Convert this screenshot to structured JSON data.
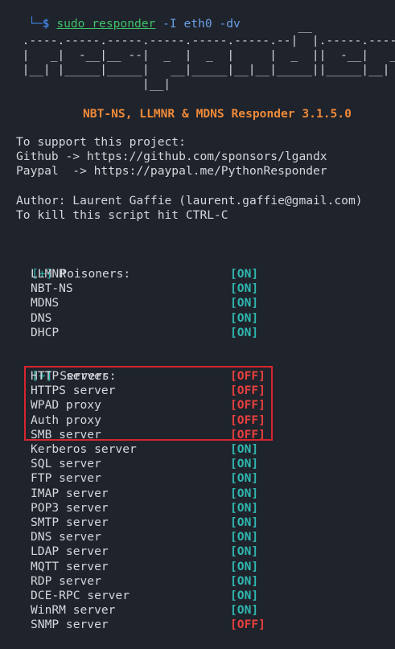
{
  "prompt": {
    "corner": "└─",
    "dollar": "$",
    "command": "sudo responder",
    "args": " -I eth0 -dv"
  },
  "banner_art": "                                         __\n  .----.-----.-----.-----.-----.-----.--|  |.-----.----.\n  |   _|  -__|__ --|  _  |  _  |     |  _  ||  -__|   _|\n  |__| |_____|_____|   __|_____|__|__|_____||_____|__|\n                   |__|",
  "title": "NBT-NS, LLMNR & MDNS Responder 3.1.5.0",
  "support": {
    "heading": "To support this project:",
    "github": "Github -> https://github.com/sponsors/lgandx",
    "paypal": "Paypal  -> https://paypal.me/PythonResponder"
  },
  "author": "Author: Laurent Gaffie (laurent.gaffie@gmail.com)",
  "kill_hint": "To kill this script hit CTRL-C",
  "poisoners": {
    "marker": "[+]",
    "heading": " Poisoners:",
    "items": [
      {
        "name": "LLMNR",
        "status": "[ON]"
      },
      {
        "name": "NBT-NS",
        "status": "[ON]"
      },
      {
        "name": "MDNS",
        "status": "[ON]"
      },
      {
        "name": "DNS",
        "status": "[ON]"
      },
      {
        "name": "DHCP",
        "status": "[ON]"
      }
    ]
  },
  "servers": {
    "marker": "[+]",
    "heading": " Servers:",
    "items": [
      {
        "name": "HTTP server",
        "status": "[OFF]"
      },
      {
        "name": "HTTPS server",
        "status": "[OFF]"
      },
      {
        "name": "WPAD proxy",
        "status": "[OFF]"
      },
      {
        "name": "Auth proxy",
        "status": "[OFF]"
      },
      {
        "name": "SMB server",
        "status": "[OFF]"
      },
      {
        "name": "Kerberos server",
        "status": "[ON]"
      },
      {
        "name": "SQL server",
        "status": "[ON]"
      },
      {
        "name": "FTP server",
        "status": "[ON]"
      },
      {
        "name": "IMAP server",
        "status": "[ON]"
      },
      {
        "name": "POP3 server",
        "status": "[ON]"
      },
      {
        "name": "SMTP server",
        "status": "[ON]"
      },
      {
        "name": "DNS server",
        "status": "[ON]"
      },
      {
        "name": "LDAP server",
        "status": "[ON]"
      },
      {
        "name": "MQTT server",
        "status": "[ON]"
      },
      {
        "name": "RDP server",
        "status": "[ON]"
      },
      {
        "name": "DCE-RPC server",
        "status": "[ON]"
      },
      {
        "name": "WinRM server",
        "status": "[ON]"
      },
      {
        "name": "SNMP server",
        "status": "[OFF]"
      }
    ]
  },
  "colors": {
    "background": "#1f232b",
    "on": "#2fb7b0",
    "off": "#e8403f",
    "title": "#f08a38",
    "highlight_box": "#d7252d"
  }
}
